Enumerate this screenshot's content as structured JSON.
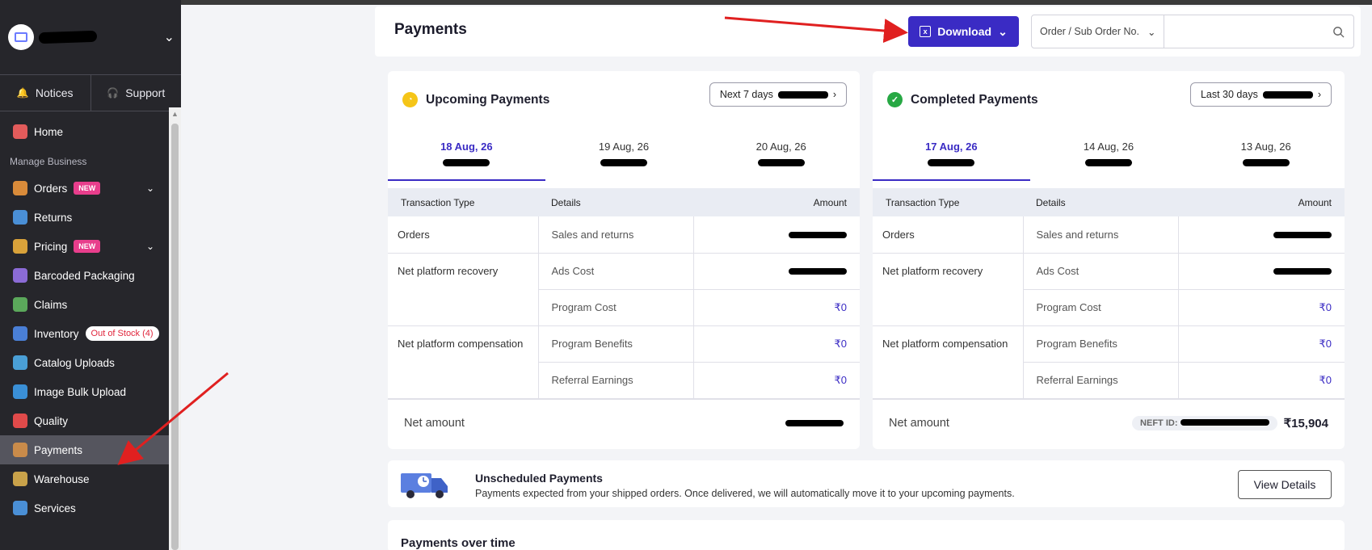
{
  "sidebar": {
    "tabs": [
      {
        "label": "Notices",
        "icon": "bell-icon"
      },
      {
        "label": "Support",
        "icon": "headset-icon"
      }
    ],
    "section_label": "Manage Business",
    "items": [
      {
        "label": "Home",
        "icon": "home-icon",
        "color": "#e25b5b"
      },
      {
        "label": "Orders",
        "icon": "orders-icon",
        "badge": "NEW",
        "color": "#d98b3a"
      },
      {
        "label": "Returns",
        "icon": "returns-icon",
        "color": "#4a8fd6"
      },
      {
        "label": "Pricing",
        "icon": "pricing-icon",
        "badge": "NEW",
        "color": "#d9a23a"
      },
      {
        "label": "Barcoded Packaging",
        "icon": "barcode-icon",
        "color": "#8b6bd6"
      },
      {
        "label": "Claims",
        "icon": "claims-icon",
        "color": "#5ba85b"
      },
      {
        "label": "Inventory",
        "icon": "inventory-icon",
        "badge": "Out of Stock (4)",
        "color": "#4a7fd6"
      },
      {
        "label": "Catalog Uploads",
        "icon": "catalog-icon",
        "color": "#4a9fd6"
      },
      {
        "label": "Image Bulk Upload",
        "icon": "image-icon",
        "color": "#3a8fd6"
      },
      {
        "label": "Quality",
        "icon": "quality-icon",
        "color": "#e04a4a"
      },
      {
        "label": "Payments",
        "icon": "wallet-icon",
        "color": "#c98b4a"
      },
      {
        "label": "Warehouse",
        "icon": "warehouse-icon",
        "color": "#c9a24a"
      },
      {
        "label": "Services",
        "icon": "services-icon",
        "color": "#4a8fd6"
      }
    ]
  },
  "header": {
    "title": "Payments",
    "download_label": "Download",
    "search_select": "Order / Sub Order No.",
    "search_placeholder": ""
  },
  "upcoming": {
    "title": "Upcoming Payments",
    "range": "Next 7 days",
    "dates": [
      "18 Aug, 26",
      "19 Aug, 26",
      "20 Aug, 26"
    ],
    "columns": [
      "Transaction Type",
      "Details",
      "Amount"
    ],
    "rows": [
      {
        "type": "Orders",
        "detail": "Sales and returns",
        "amount": ""
      },
      {
        "type": "Net platform recovery",
        "detail": "Ads Cost",
        "amount": ""
      },
      {
        "type": "",
        "detail": "Program Cost",
        "amount": "₹0"
      },
      {
        "type": "Net platform compensation",
        "detail": "Program Benefits",
        "amount": "₹0"
      },
      {
        "type": "",
        "detail": "Referral Earnings",
        "amount": "₹0"
      }
    ],
    "net_label": "Net amount"
  },
  "completed": {
    "title": "Completed Payments",
    "range": "Last 30 days",
    "dates": [
      "17 Aug, 26",
      "14 Aug, 26",
      "13 Aug, 26"
    ],
    "columns": [
      "Transaction Type",
      "Details",
      "Amount"
    ],
    "rows": [
      {
        "type": "Orders",
        "detail": "Sales and returns",
        "amount": ""
      },
      {
        "type": "Net platform recovery",
        "detail": "Ads Cost",
        "amount": ""
      },
      {
        "type": "",
        "detail": "Program Cost",
        "amount": "₹0"
      },
      {
        "type": "Net platform compensation",
        "detail": "Program Benefits",
        "amount": "₹0"
      },
      {
        "type": "",
        "detail": "Referral Earnings",
        "amount": "₹0"
      }
    ],
    "net_label": "Net amount",
    "neft_label": "NEFT ID:",
    "net_amount": "₹15,904"
  },
  "unscheduled": {
    "title": "Unscheduled Payments",
    "description": "Payments expected from your shipped orders. Once delivered, we will automatically move it to your upcoming payments.",
    "button": "View Details"
  },
  "payments_over_time": {
    "title": "Payments over time"
  },
  "colors": {
    "accent": "#3a2bc4",
    "sidebar": "#26262b",
    "annotation": "#e02020"
  }
}
